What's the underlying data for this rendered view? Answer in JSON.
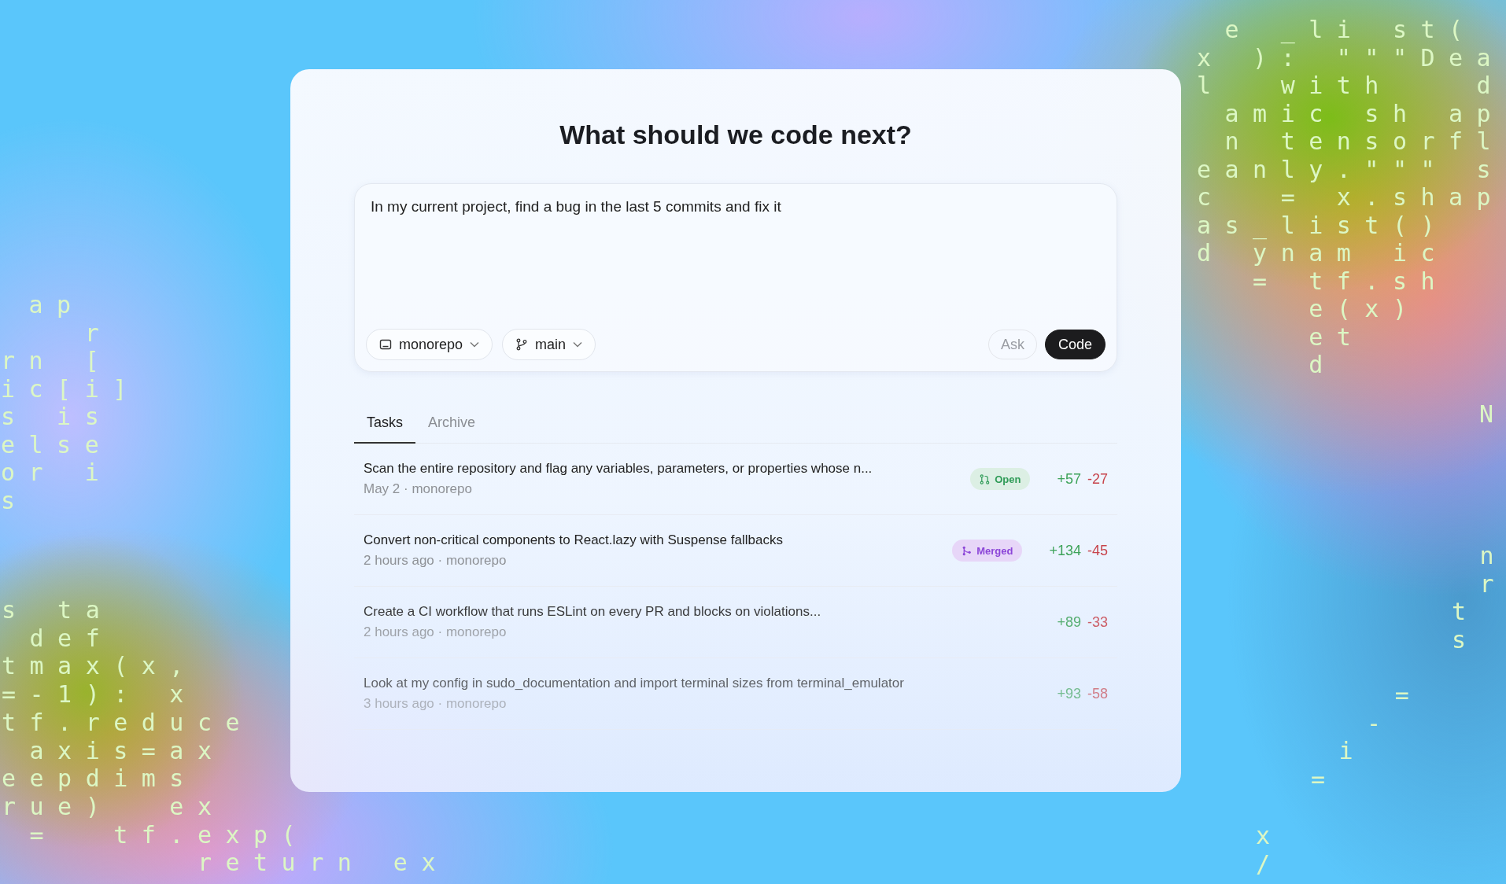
{
  "background_code": [
    {
      "lines": [
        " e _li st(",
        "x ): \"\"\"Dea",
        "l  with   d",
        " amic sh ap",
        " n tensorfl",
        "eanly.\"\"\" s",
        "c  = x.shap",
        "as_list()",
        "d ynam ic",
        "  = tf.sh",
        "    e(x)",
        "    et",
        "    d"
      ]
    },
    {
      "lines": [
        " ap",
        "   r",
        "rn [",
        "ic[i]",
        "s is",
        "else",
        "or i",
        "s"
      ]
    },
    {
      "lines": [
        "s ta",
        " def",
        "tmax(x,",
        "=-1): x",
        "tf.reduce",
        " axis=ax",
        "eepdims",
        "rue)  ex",
        " =  tf.exp(",
        "       return ex"
      ]
    },
    {
      "lines": [
        "N"
      ]
    },
    {
      "lines": [
        " n",
        " r",
        "t",
        "s"
      ]
    },
    {
      "lines": [
        "   =",
        "  -",
        " i",
        "="
      ]
    },
    {
      "lines": [
        "x",
        "/"
      ]
    }
  ],
  "heading": "What should we code next?",
  "composer": {
    "value": "In my current project, find a bug in the last 5 commits and fix it",
    "repo": {
      "label": "monorepo"
    },
    "branch": {
      "label": "main"
    },
    "buttons": [
      {
        "label": "Ask",
        "kind": "secondary"
      },
      {
        "label": "Code",
        "kind": "primary"
      }
    ]
  },
  "tabs": [
    {
      "label": "Tasks",
      "selected": true
    },
    {
      "label": "Archive",
      "selected": false
    }
  ],
  "tasks": [
    {
      "title": "Scan the entire repository and flag any variables, parameters, or properties whose n...",
      "meta": "May 2 · monorepo",
      "status": {
        "kind": "open",
        "label": "Open"
      },
      "additions": "+57",
      "deletions": "-27"
    },
    {
      "title": "Convert non-critical components to React.lazy with Suspense fallbacks",
      "meta": "2 hours ago · monorepo",
      "status": {
        "kind": "merged",
        "label": "Merged"
      },
      "additions": "+134",
      "deletions": "-45"
    },
    {
      "title": "Create a CI workflow that runs ESLint on every PR and blocks on violations...",
      "meta": "2 hours ago · monorepo",
      "additions": "+89",
      "deletions": "-33"
    },
    {
      "title": "Look at my config in sudo_documentation and import terminal sizes from terminal_emulator",
      "meta": "3 hours ago · monorepo",
      "additions": "+93",
      "deletions": "-58"
    }
  ]
}
